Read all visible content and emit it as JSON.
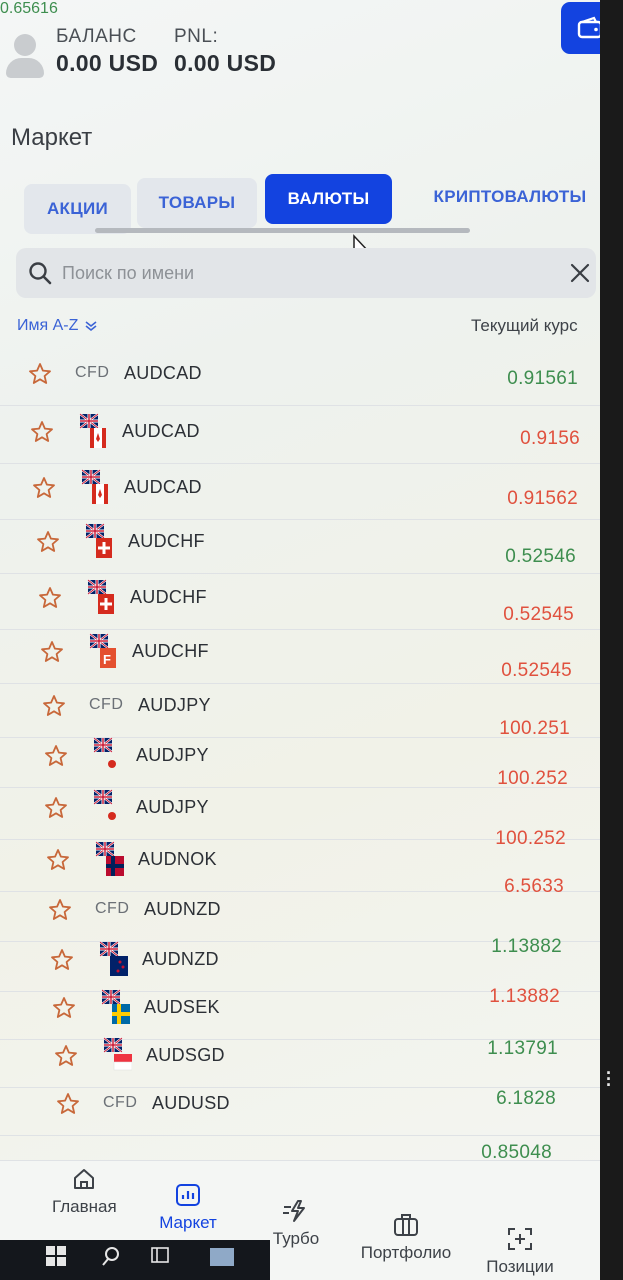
{
  "header": {
    "balance_label": "БАЛАНС",
    "balance_value": "0.00 USD",
    "pnl_label": "PNL:",
    "pnl_value": "0.00 USD"
  },
  "page_title": "Маркет",
  "tabs": [
    {
      "label": "АКЦИИ",
      "active": false
    },
    {
      "label": "ТОВАРЫ",
      "active": false
    },
    {
      "label": "ВАЛЮТЫ",
      "active": true
    },
    {
      "label": "КРИПТОВАЛЮТЫ",
      "active": false
    }
  ],
  "search": {
    "placeholder": "Поиск по имени"
  },
  "sort": {
    "label": "Имя A-Z"
  },
  "column_header": "Текущий курс",
  "rows": [
    {
      "type": "CFD",
      "flag": "cfd",
      "symbol": "AUDCAD",
      "price": "0.91561",
      "trend": "up"
    },
    {
      "type": "",
      "flag": "au-ca",
      "symbol": "AUDCAD",
      "price": "0.9156",
      "trend": "down"
    },
    {
      "type": "",
      "flag": "au-ca",
      "symbol": "AUDCAD",
      "price": "0.91562",
      "trend": "down"
    },
    {
      "type": "",
      "flag": "au-ch",
      "symbol": "AUDCHF",
      "price": "0.52546",
      "trend": "up"
    },
    {
      "type": "",
      "flag": "au-ch",
      "symbol": "AUDCHF",
      "price": "0.52545",
      "trend": "down"
    },
    {
      "type": "",
      "flag": "au-f",
      "symbol": "AUDCHF",
      "price": "0.52545",
      "trend": "down"
    },
    {
      "type": "CFD",
      "flag": "cfd",
      "symbol": "AUDJPY",
      "price": "100.251",
      "trend": "down"
    },
    {
      "type": "",
      "flag": "au-jp",
      "symbol": "AUDJPY",
      "price": "100.252",
      "trend": "down"
    },
    {
      "type": "",
      "flag": "au-jp",
      "symbol": "AUDJPY",
      "price": "100.252",
      "trend": "down"
    },
    {
      "type": "",
      "flag": "au-no",
      "symbol": "AUDNOK",
      "price": "6.5633",
      "trend": "down"
    },
    {
      "type": "CFD",
      "flag": "cfd",
      "symbol": "AUDNZD",
      "price": "1.13882",
      "trend": "up"
    },
    {
      "type": "",
      "flag": "au-nz",
      "symbol": "AUDNZD",
      "price": "1.13882",
      "trend": "down"
    },
    {
      "type": "",
      "flag": "au-se",
      "symbol": "AUDSEK",
      "price": "1.13791",
      "trend": "up"
    },
    {
      "type": "",
      "flag": "au-sg",
      "symbol": "AUDSGD",
      "price": "6.1828",
      "trend": "up"
    },
    {
      "type": "CFD",
      "flag": "cfd",
      "symbol": "AUDUSD",
      "price": "0.85048",
      "trend": "up"
    }
  ],
  "partial_price": {
    "price": "0.65616",
    "trend": "up"
  },
  "bottom_nav": [
    {
      "label": "Главная",
      "icon": "home-icon",
      "active": false
    },
    {
      "label": "Маркет",
      "icon": "chart-icon",
      "active": true
    },
    {
      "label": "Турбо",
      "icon": "turbo-icon",
      "active": false
    },
    {
      "label": "Портфолио",
      "icon": "briefcase-icon",
      "active": false
    },
    {
      "label": "Позиции",
      "icon": "positions-icon",
      "active": false
    }
  ],
  "colors": {
    "accent": "#1343e0",
    "price_up": "#3e8e4f",
    "price_down": "#e0513e",
    "star": "#c8683a"
  }
}
